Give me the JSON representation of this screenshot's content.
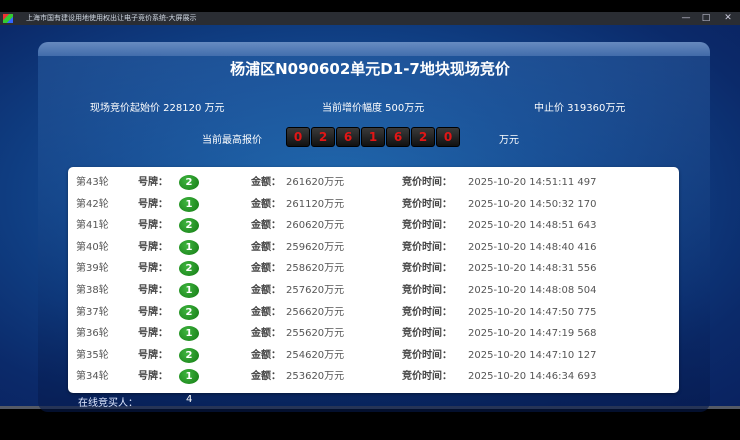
{
  "window": {
    "title": "上海市国有建设用地使用权出让电子竞价系统-大屏展示",
    "minimize": "—",
    "maximize": "□",
    "close": "✕"
  },
  "header": {
    "title": "杨浦区N090602单元D1-7地块现场竞价",
    "start_price": "现场竞价起始价 228120 万元",
    "increment": "当前增价幅度 500万元",
    "stop_price": "中止价 319360万元",
    "highest_label": "当前最高报价",
    "highest_digits": [
      "0",
      "2",
      "6",
      "1",
      "6",
      "2",
      "0"
    ],
    "highest_unit": "万元"
  },
  "table": {
    "plate_label": "号牌：",
    "amount_label": "金额：",
    "time_label": "竞价时间：",
    "rows": [
      {
        "round": "第43轮",
        "plate": "2",
        "amount": "261620万元",
        "time": "2025-10-20 14:51:11 497"
      },
      {
        "round": "第42轮",
        "plate": "1",
        "amount": "261120万元",
        "time": "2025-10-20 14:50:32 170"
      },
      {
        "round": "第41轮",
        "plate": "2",
        "amount": "260620万元",
        "time": "2025-10-20 14:48:51 643"
      },
      {
        "round": "第40轮",
        "plate": "1",
        "amount": "259620万元",
        "time": "2025-10-20 14:48:40 416"
      },
      {
        "round": "第39轮",
        "plate": "2",
        "amount": "258620万元",
        "time": "2025-10-20 14:48:31 556"
      },
      {
        "round": "第38轮",
        "plate": "1",
        "amount": "257620万元",
        "time": "2025-10-20 14:48:08 504"
      },
      {
        "round": "第37轮",
        "plate": "2",
        "amount": "256620万元",
        "time": "2025-10-20 14:47:50 775"
      },
      {
        "round": "第36轮",
        "plate": "1",
        "amount": "255620万元",
        "time": "2025-10-20 14:47:19 568"
      },
      {
        "round": "第35轮",
        "plate": "2",
        "amount": "254620万元",
        "time": "2025-10-20 14:47:10 127"
      },
      {
        "round": "第34轮",
        "plate": "1",
        "amount": "253620万元",
        "time": "2025-10-20 14:46:34 693"
      }
    ]
  },
  "footer": {
    "online_label": "在线竞买人：",
    "online_count": "4"
  }
}
